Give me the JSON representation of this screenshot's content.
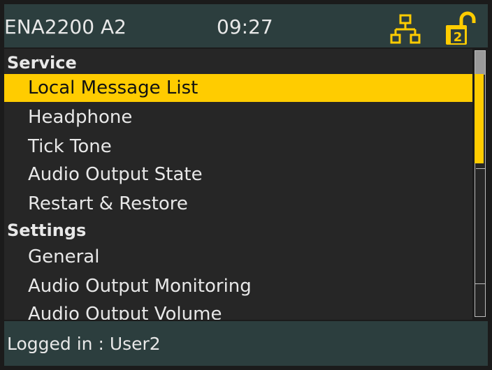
{
  "header": {
    "device": "ENA2200 A2",
    "time": "09:27",
    "lock_level": "2",
    "icons": [
      "network-icon",
      "unlock-icon"
    ]
  },
  "menu": {
    "sections": [
      {
        "title": "Service",
        "items": [
          {
            "label": "Local Message List",
            "selected": true
          },
          {
            "label": "Headphone"
          },
          {
            "label": "Tick Tone"
          },
          {
            "label": "Audio Output State"
          },
          {
            "label": "Restart & Restore"
          }
        ]
      },
      {
        "title": "Settings",
        "items": [
          {
            "label": "General"
          },
          {
            "label": "Audio Output Monitoring"
          },
          {
            "label": "Audio Output Volume"
          }
        ]
      }
    ]
  },
  "footer": {
    "status": "Logged in : User2"
  },
  "colors": {
    "header_bg": "#2c3e3e",
    "list_bg": "#262626",
    "accent": "#ffcc00",
    "text": "#e8e8e8"
  }
}
